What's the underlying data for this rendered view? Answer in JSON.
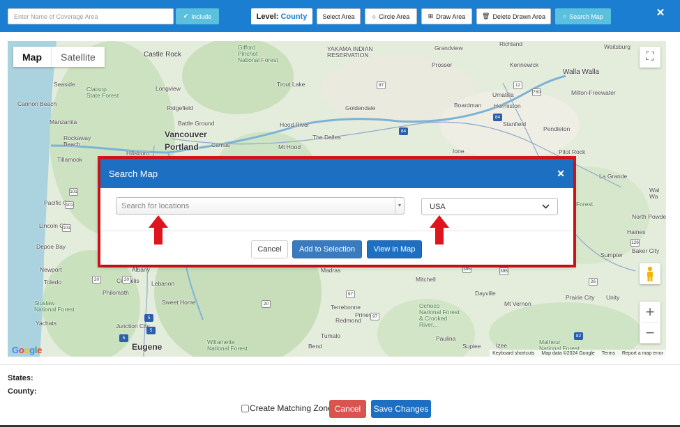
{
  "colors": {
    "primary": "#1c7ed1",
    "dialog_header": "#1c6fc1",
    "info_button": "#5bc0de",
    "danger": "#d9534f",
    "highlight": "#e0141c",
    "google_blue": "#4285f4",
    "google_red": "#ea4335",
    "google_yellow": "#fbbc05",
    "google_green": "#34a853"
  },
  "toolbar": {
    "coverage_placeholder": "Enter Name of Coverage Area",
    "include_label": "Include",
    "level_label": "Level:",
    "level_value": "County",
    "select_area_label": "Select Area",
    "circle_area_label": "Circle Area",
    "draw_area_label": "Draw Area",
    "delete_drawn_area_label": "Delete Drawn Area",
    "search_map_label": "Search Map",
    "close_symbol": "✕"
  },
  "map": {
    "tabs": [
      "Map",
      "Satellite"
    ],
    "logo": [
      "G",
      "o",
      "o",
      "g",
      "l",
      "e"
    ],
    "attribution": [
      "Keyboard shortcuts",
      "Map data ©2024 Google",
      "Terms",
      "Report a map error"
    ],
    "labels": [
      {
        "text": "Castle Rock",
        "kind": "city"
      },
      {
        "text": "Gifford\nPinchot\nNational Forest",
        "kind": "park"
      },
      {
        "text": "YAKAMA INDIAN\nRESERVATION",
        "kind": "plain"
      },
      {
        "text": "Grandview",
        "kind": "plain"
      },
      {
        "text": "Richland",
        "kind": "plain"
      },
      {
        "text": "Waitsburg",
        "kind": "plain"
      },
      {
        "text": "Prosser",
        "kind": "plain"
      },
      {
        "text": "Kennewick",
        "kind": "plain"
      },
      {
        "text": "Walla Walla",
        "kind": "city"
      },
      {
        "text": "Seaside",
        "kind": "plain"
      },
      {
        "text": "Clatsop\nState Forest",
        "kind": "park"
      },
      {
        "text": "Longview",
        "kind": "plain"
      },
      {
        "text": "Trout Lake",
        "kind": "plain"
      },
      {
        "text": "Umatilla",
        "kind": "plain"
      },
      {
        "text": "Milton-Freewater",
        "kind": "plain"
      },
      {
        "text": "Cannon Beach",
        "kind": "plain"
      },
      {
        "text": "Ridgefield",
        "kind": "plain"
      },
      {
        "text": "Goldendale",
        "kind": "plain"
      },
      {
        "text": "Boardman",
        "kind": "plain"
      },
      {
        "text": "Hermiston",
        "kind": "plain"
      },
      {
        "text": "Manzanita",
        "kind": "plain"
      },
      {
        "text": "Battle Ground",
        "kind": "plain"
      },
      {
        "text": "Hood River",
        "kind": "plain"
      },
      {
        "text": "Stanfield",
        "kind": "plain"
      },
      {
        "text": "Pendleton",
        "kind": "plain"
      },
      {
        "text": "Vancouver",
        "kind": "big"
      },
      {
        "text": "Rockaway\nBeach",
        "kind": "plain"
      },
      {
        "text": "Portland",
        "kind": "big"
      },
      {
        "text": "Camas",
        "kind": "plain"
      },
      {
        "text": "The Dalles",
        "kind": "plain"
      },
      {
        "text": "Mt Hood",
        "kind": "plain"
      },
      {
        "text": "Hillsboro",
        "kind": "plain"
      },
      {
        "text": "Tillamook",
        "kind": "plain"
      },
      {
        "text": "Ione",
        "kind": "plain"
      },
      {
        "text": "Pilot Rock",
        "kind": "plain"
      },
      {
        "text": "La Grande",
        "kind": "plain"
      },
      {
        "text": "Wal\nWa",
        "kind": "plain"
      },
      {
        "text": "Pacific City",
        "kind": "plain"
      },
      {
        "text": "Forest",
        "kind": "park"
      },
      {
        "text": "North Powder",
        "kind": "plain"
      },
      {
        "text": "Lincoln City",
        "kind": "plain"
      },
      {
        "text": "Haines",
        "kind": "plain"
      },
      {
        "text": "Depoe Bay",
        "kind": "plain"
      },
      {
        "text": "Baker City",
        "kind": "plain"
      },
      {
        "text": "Sumpter",
        "kind": "plain"
      },
      {
        "text": "Newport",
        "kind": "plain"
      },
      {
        "text": "Albany",
        "kind": "plain"
      },
      {
        "text": "Madras",
        "kind": "plain"
      },
      {
        "text": "Mitchell",
        "kind": "plain"
      },
      {
        "text": "Toledo",
        "kind": "plain"
      },
      {
        "text": "Corvallis",
        "kind": "plain"
      },
      {
        "text": "Lebanon",
        "kind": "plain"
      },
      {
        "text": "Philomath",
        "kind": "plain"
      },
      {
        "text": "Dayville",
        "kind": "plain"
      },
      {
        "text": "Prairie City",
        "kind": "plain"
      },
      {
        "text": "Unity",
        "kind": "plain"
      },
      {
        "text": "Siuslaw\nNational Forest",
        "kind": "park"
      },
      {
        "text": "Sweet Home",
        "kind": "plain"
      },
      {
        "text": "Terrebonne",
        "kind": "plain"
      },
      {
        "text": "Prineville",
        "kind": "plain"
      },
      {
        "text": "Ochoco\nNational Forest\n& Crooked\nRiver...",
        "kind": "park"
      },
      {
        "text": "Mt Vernon",
        "kind": "plain"
      },
      {
        "text": "Yachats",
        "kind": "plain"
      },
      {
        "text": "Junction City",
        "kind": "plain"
      },
      {
        "text": "Redmond",
        "kind": "plain"
      },
      {
        "text": "Tumalo",
        "kind": "plain"
      },
      {
        "text": "Paulina",
        "kind": "plain"
      },
      {
        "text": "Eugene",
        "kind": "big"
      },
      {
        "text": "Willamette\nNational Forest",
        "kind": "park"
      },
      {
        "text": "Bend",
        "kind": "plain"
      },
      {
        "text": "Suplee",
        "kind": "plain"
      },
      {
        "text": "Izee",
        "kind": "plain"
      },
      {
        "text": "Malheur\nNational Forest",
        "kind": "park"
      }
    ],
    "shields": [
      "97",
      "12",
      "730",
      "84",
      "84",
      "101",
      "101",
      "101",
      "20",
      "20",
      "5",
      "20",
      "395",
      "26",
      "126",
      "97",
      "395",
      "97",
      "5",
      "82",
      "5"
    ]
  },
  "dialog": {
    "title": "Search Map",
    "close_symbol": "✕",
    "location_placeholder": "Search for locations",
    "country_value": "USA",
    "cancel_label": "Cancel",
    "add_label": "Add to Selection",
    "view_label": "View in Map"
  },
  "footer": {
    "states_label": "States:",
    "county_label": "County:",
    "create_matching_zone_label": "Create Matching Zone",
    "cancel_label": "Cancel",
    "save_label": "Save Changes"
  }
}
